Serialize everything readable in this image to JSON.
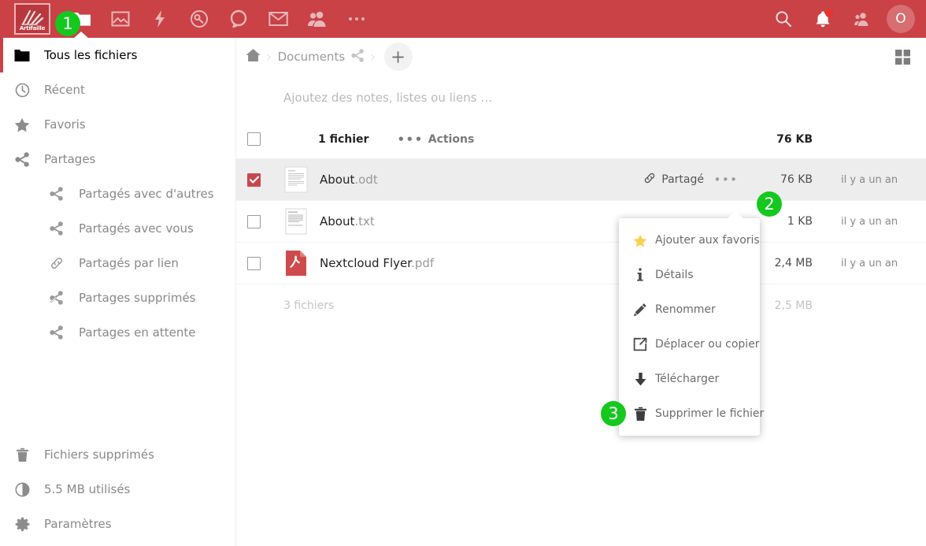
{
  "header": {
    "logo_label": "Artifaille",
    "nav_items": [
      {
        "name": "files-app",
        "icon": "folder-icon",
        "active": true
      },
      {
        "name": "photos-app",
        "icon": "image-icon",
        "active": false
      },
      {
        "name": "activity-app",
        "icon": "lightning-icon",
        "active": false
      },
      {
        "name": "passwords-app",
        "icon": "key-circle-icon",
        "active": false
      },
      {
        "name": "talk-app",
        "icon": "speech-bubble-icon",
        "active": false
      },
      {
        "name": "mail-app",
        "icon": "envelope-icon",
        "active": false
      },
      {
        "name": "contacts-app",
        "icon": "people-icon",
        "active": false
      },
      {
        "name": "more-apps",
        "icon": "ellipsis-icon",
        "active": false
      }
    ],
    "right_items": [
      {
        "name": "search",
        "icon": "search-icon"
      },
      {
        "name": "notifications",
        "icon": "bell-icon"
      },
      {
        "name": "contacts-menu",
        "icon": "contacts-icon"
      }
    ],
    "avatar_initial": "O",
    "accent_color": "#ca4146",
    "badge_color": "#14c81e"
  },
  "sidebar": {
    "items": [
      {
        "label": "Tous les fichiers",
        "icon": "folder-icon"
      },
      {
        "label": "Récent",
        "icon": "clock-icon"
      },
      {
        "label": "Favoris",
        "icon": "star-icon"
      },
      {
        "label": "Partages",
        "icon": "share-icon"
      },
      {
        "label": "Partagés avec d'autres",
        "icon": "share-icon"
      },
      {
        "label": "Partagés avec vous",
        "icon": "share-icon"
      },
      {
        "label": "Partagés par lien",
        "icon": "link-icon"
      },
      {
        "label": "Partages supprimés",
        "icon": "share-off-icon"
      },
      {
        "label": "Partages en attente",
        "icon": "share-icon"
      }
    ],
    "bottom_items": [
      {
        "label": "Fichiers supprimés",
        "icon": "trash-icon"
      },
      {
        "label": "5.5 MB utilisés",
        "icon": "quota-pie-icon"
      },
      {
        "label": "Paramètres",
        "icon": "gear-icon"
      }
    ]
  },
  "breadcrumb": {
    "home_icon": "home-icon",
    "folder": "Documents",
    "shared_icon": "share-icon",
    "new_button_label": "+"
  },
  "notes": {
    "placeholder": "Ajoutez des notes, listes ou liens …"
  },
  "table": {
    "header": {
      "count": "1 fichier",
      "actions_label": "Actions",
      "size": "76 KB"
    },
    "rows": [
      {
        "name": "About",
        "ext": ".odt",
        "icon": "odt-document-thumbnail",
        "checked": true,
        "selected": true,
        "share_label": "Partagé",
        "share_icon": "link-icon",
        "size": "76 KB",
        "modified": "il y a un an"
      },
      {
        "name": "About",
        "ext": ".txt",
        "icon": "txt-document-thumbnail",
        "checked": false,
        "selected": false,
        "share_label": "",
        "share_icon": "",
        "size": "1 KB",
        "modified": "il y a un an"
      },
      {
        "name": "Nextcloud Flyer",
        "ext": ".pdf",
        "icon": "pdf-file-icon",
        "checked": false,
        "selected": false,
        "share_label": "",
        "share_icon": "",
        "size": "2,4 MB",
        "modified": "il y a un an"
      }
    ],
    "summary": {
      "count": "3 fichiers",
      "size": "2,5 MB",
      "date": ""
    }
  },
  "context_menu": {
    "items": [
      {
        "label": "Ajouter aux favoris",
        "icon": "star-icon"
      },
      {
        "label": "Détails",
        "icon": "info-icon"
      },
      {
        "label": "Renommer",
        "icon": "pencil-icon"
      },
      {
        "label": "Déplacer ou copier",
        "icon": "external-link-icon"
      },
      {
        "label": "Télécharger",
        "icon": "download-icon"
      },
      {
        "label": "Supprimer le fichier",
        "icon": "trash-icon"
      }
    ]
  },
  "step_badges": [
    {
      "number": "1"
    },
    {
      "number": "2"
    },
    {
      "number": "3"
    }
  ],
  "view_toggle": {
    "icon": "grid-view-icon"
  }
}
